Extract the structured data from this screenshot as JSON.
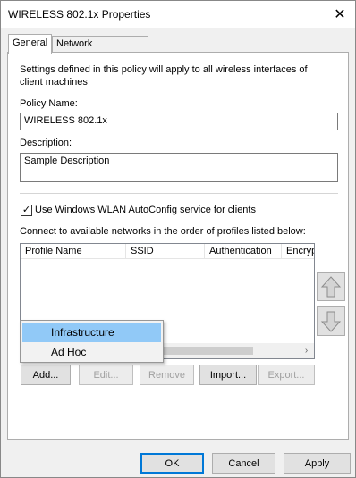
{
  "window": {
    "title": "WIRELESS 802.1x Properties",
    "close_glyph": "✕"
  },
  "tabs": [
    {
      "label": "General",
      "active": true
    },
    {
      "label": "Network Permissions",
      "active": false
    }
  ],
  "general": {
    "intro_text": "Settings defined in this policy will apply to all wireless interfaces of client machines",
    "policy_name_label": "Policy Name:",
    "policy_name_value": "WIRELESS 802.1x",
    "description_label": "Description:",
    "description_value": "Sample Description",
    "wlan_checkbox_label": "Use Windows WLAN AutoConfig service for clients",
    "wlan_checkbox_checked": true,
    "check_glyph": "✓",
    "profiles_label": "Connect to available networks in the order of profiles listed below:",
    "profile_columns": [
      "Profile Name",
      "SSID",
      "Authentication",
      "Encryption"
    ],
    "scroll_right_glyph": "›",
    "add_button": "Add...",
    "edit_button": "Edit...",
    "remove_button": "Remove",
    "import_button": "Import...",
    "export_button": "Export...",
    "move_up_icon": "arrow-up-icon",
    "move_down_icon": "arrow-down-icon"
  },
  "add_menu": {
    "items": [
      "Infrastructure",
      "Ad Hoc"
    ],
    "highlighted": "Infrastructure",
    "highlight_color": "#91c9f7"
  },
  "dialog_buttons": {
    "ok": "OK",
    "cancel": "Cancel",
    "apply": "Apply"
  }
}
